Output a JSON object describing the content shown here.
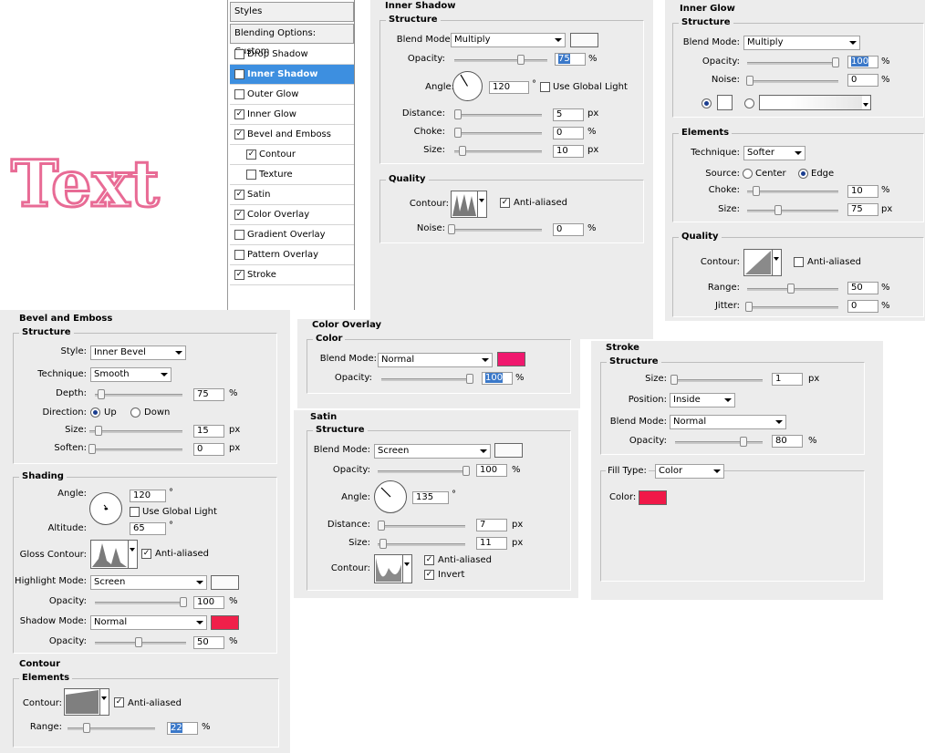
{
  "preview_text": "Text",
  "styles_panel": {
    "title": "Styles",
    "blending": "Blending Options: Custom",
    "items": [
      {
        "label": "Drop Shadow",
        "checked": false
      },
      {
        "label": "Inner Shadow",
        "checked": true,
        "active": true
      },
      {
        "label": "Outer Glow",
        "checked": false
      },
      {
        "label": "Inner Glow",
        "checked": true
      },
      {
        "label": "Bevel and Emboss",
        "checked": true
      },
      {
        "label": "Contour",
        "checked": true,
        "sub": true
      },
      {
        "label": "Texture",
        "checked": false,
        "sub": true
      },
      {
        "label": "Satin",
        "checked": true
      },
      {
        "label": "Color Overlay",
        "checked": true
      },
      {
        "label": "Gradient Overlay",
        "checked": false
      },
      {
        "label": "Pattern Overlay",
        "checked": false
      },
      {
        "label": "Stroke",
        "checked": true
      }
    ]
  },
  "inner_shadow": {
    "title": "Inner Shadow",
    "structure": "Structure",
    "blend_mode_label": "Blend Mode:",
    "blend_mode": "Multiply",
    "opacity_label": "Opacity:",
    "opacity": "75",
    "angle_label": "Angle:",
    "angle": "120",
    "use_global_light": "Use Global Light",
    "distance_label": "Distance:",
    "distance": "5",
    "choke_label": "Choke:",
    "choke": "0",
    "size_label": "Size:",
    "size": "10",
    "quality": "Quality",
    "contour_label": "Contour:",
    "anti_aliased": "Anti-aliased",
    "noise_label": "Noise:",
    "noise": "0"
  },
  "inner_glow": {
    "title": "Inner Glow",
    "structure": "Structure",
    "blend_mode_label": "Blend Mode:",
    "blend_mode": "Multiply",
    "opacity_label": "Opacity:",
    "opacity": "100",
    "noise_label": "Noise:",
    "noise": "0",
    "elements": "Elements",
    "technique_label": "Technique:",
    "technique": "Softer",
    "source_label": "Source:",
    "center": "Center",
    "edge": "Edge",
    "choke_label": "Choke:",
    "choke": "10",
    "size_label": "Size:",
    "size": "75",
    "quality": "Quality",
    "contour_label": "Contour:",
    "anti_aliased": "Anti-aliased",
    "range_label": "Range:",
    "range": "50",
    "jitter_label": "Jitter:",
    "jitter": "0"
  },
  "bevel": {
    "title": "Bevel and Emboss",
    "structure": "Structure",
    "style_label": "Style:",
    "style": "Inner Bevel",
    "technique_label": "Technique:",
    "technique": "Smooth",
    "depth_label": "Depth:",
    "depth": "75",
    "direction_label": "Direction:",
    "up": "Up",
    "down": "Down",
    "size_label": "Size:",
    "size": "15",
    "soften_label": "Soften:",
    "soften": "0",
    "shading": "Shading",
    "angle_label": "Angle:",
    "angle": "120",
    "use_global_light": "Use Global Light",
    "altitude_label": "Altitude:",
    "altitude": "65",
    "gloss_label": "Gloss Contour:",
    "anti_aliased": "Anti-aliased",
    "highlight_label": "Highlight Mode:",
    "highlight_mode": "Screen",
    "h_opacity_label": "Opacity:",
    "h_opacity": "100",
    "shadow_label": "Shadow Mode:",
    "shadow_mode": "Normal",
    "s_opacity_label": "Opacity:",
    "s_opacity": "50"
  },
  "contour_panel": {
    "title": "Contour",
    "elements": "Elements",
    "contour_label": "Contour:",
    "anti_aliased": "Anti-aliased",
    "range_label": "Range:",
    "range": "22"
  },
  "color_overlay": {
    "title": "Color Overlay",
    "color": "Color",
    "blend_mode_label": "Blend Mode:",
    "blend_mode": "Normal",
    "opacity_label": "Opacity:",
    "opacity": "100"
  },
  "satin": {
    "title": "Satin",
    "structure": "Structure",
    "blend_mode_label": "Blend Mode:",
    "blend_mode": "Screen",
    "opacity_label": "Opacity:",
    "opacity": "100",
    "angle_label": "Angle:",
    "angle": "135",
    "distance_label": "Distance:",
    "distance": "7",
    "size_label": "Size:",
    "size": "11",
    "contour_label": "Contour:",
    "anti_aliased": "Anti-aliased",
    "invert": "Invert"
  },
  "stroke": {
    "title": "Stroke",
    "structure": "Structure",
    "size_label": "Size:",
    "size": "1",
    "position_label": "Position:",
    "position": "Inside",
    "blend_mode_label": "Blend Mode:",
    "blend_mode": "Normal",
    "opacity_label": "Opacity:",
    "opacity": "80",
    "fill_type_label": "Fill Type:",
    "fill_type": "Color",
    "color_label": "Color:"
  },
  "units": {
    "px": "px",
    "pct": "%",
    "deg": "°"
  },
  "colors": {
    "pink": "#f0186e",
    "red": "#f01848",
    "bevel_shadow": "#f0204a",
    "active": "#3d8fe0"
  }
}
